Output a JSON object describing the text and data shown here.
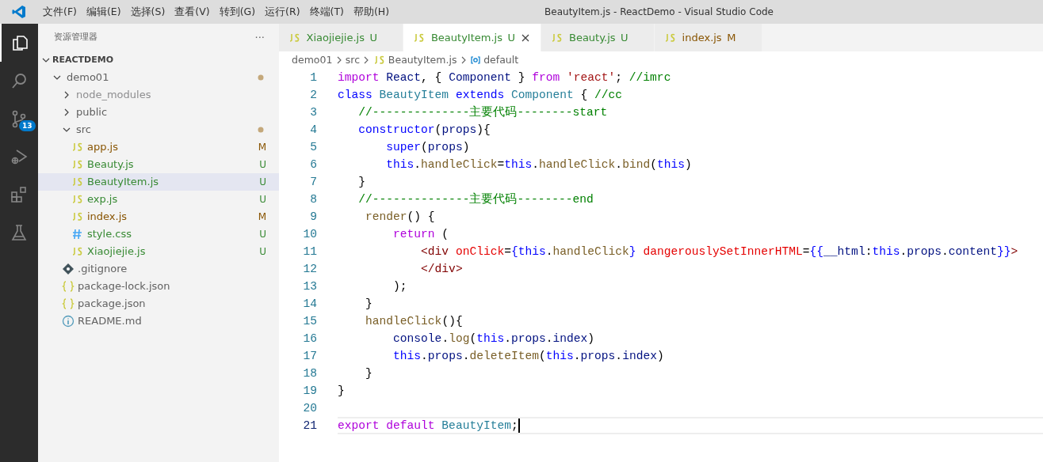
{
  "window": {
    "title": "BeautyItem.js - ReactDemo - Visual Studio Code"
  },
  "menu": [
    "文件(F)",
    "编辑(E)",
    "选择(S)",
    "查看(V)",
    "转到(G)",
    "运行(R)",
    "终端(T)",
    "帮助(H)"
  ],
  "activity_bar": [
    {
      "kind": "explorer",
      "selected": true
    },
    {
      "kind": "search",
      "selected": false
    },
    {
      "kind": "source-control",
      "selected": false,
      "badge": "13"
    },
    {
      "kind": "run-debug",
      "selected": false
    },
    {
      "kind": "extensions",
      "selected": false
    },
    {
      "kind": "testing",
      "selected": false
    }
  ],
  "sidebar": {
    "title": "资源管理器",
    "more": "···",
    "section": {
      "label": "REACTDEMO",
      "expanded": true
    },
    "tree": [
      {
        "label": "demo01",
        "kind": "folder",
        "expanded": true,
        "changes_dot": true,
        "ignored": false,
        "selected": false,
        "children": [
          {
            "label": "node_modules",
            "kind": "folder",
            "expanded": false,
            "changes_dot": false,
            "ignored": true,
            "selected": false
          },
          {
            "label": "public",
            "kind": "folder",
            "expanded": false,
            "changes_dot": false,
            "ignored": false,
            "selected": false
          },
          {
            "label": "src",
            "kind": "folder",
            "expanded": true,
            "changes_dot": true,
            "ignored": false,
            "selected": false,
            "children": [
              {
                "label": "app.js",
                "kind": "js",
                "status": "M",
                "ignored": false,
                "selected": false
              },
              {
                "label": "Beauty.js",
                "kind": "js",
                "status": "U",
                "ignored": false,
                "selected": false
              },
              {
                "label": "BeautyItem.js",
                "kind": "js",
                "status": "U",
                "ignored": false,
                "selected": true
              },
              {
                "label": "exp.js",
                "kind": "js",
                "status": "U",
                "ignored": false,
                "selected": false
              },
              {
                "label": "index.js",
                "kind": "js",
                "status": "M",
                "ignored": false,
                "selected": false
              },
              {
                "label": "style.css",
                "kind": "css",
                "status": "U",
                "ignored": false,
                "selected": false
              },
              {
                "label": "Xiaojiejie.js",
                "kind": "js",
                "status": "U",
                "ignored": false,
                "selected": false
              }
            ]
          },
          {
            "label": ".gitignore",
            "kind": "git",
            "ignored": false,
            "selected": false
          },
          {
            "label": "package-lock.json",
            "kind": "json",
            "ignored": false,
            "selected": false
          },
          {
            "label": "package.json",
            "kind": "json",
            "ignored": false,
            "selected": false
          },
          {
            "label": "README.md",
            "kind": "info",
            "ignored": false,
            "selected": false
          }
        ]
      }
    ]
  },
  "tabs": [
    {
      "label": "Xiaojiejie.js",
      "status": "U",
      "selected": false
    },
    {
      "label": "BeautyItem.js",
      "status": "U",
      "selected": true
    },
    {
      "label": "Beauty.js",
      "status": "U",
      "selected": false
    },
    {
      "label": "index.js",
      "status": "M",
      "selected": false
    }
  ],
  "breadcrumb": [
    {
      "label": "demo01",
      "kind": "folder"
    },
    {
      "label": "src",
      "kind": "folder"
    },
    {
      "label": "BeautyItem.js",
      "kind": "js"
    },
    {
      "label": "default",
      "kind": "symbol"
    }
  ],
  "editor": {
    "lines": [
      {
        "number": "1",
        "current": false,
        "tokens": [
          {
            "text": "import",
            "kind": "kw"
          },
          {
            "text": " React",
            "kind": "va"
          },
          {
            "text": ", { ",
            "kind": "pl"
          },
          {
            "text": "Component",
            "kind": "va"
          },
          {
            "text": " } ",
            "kind": "pl"
          },
          {
            "text": "from",
            "kind": "kw"
          },
          {
            "text": " 'react'",
            "kind": "str"
          },
          {
            "text": "; ",
            "kind": "pl"
          },
          {
            "text": "//imrc",
            "kind": "cm"
          }
        ]
      },
      {
        "number": "2",
        "current": false,
        "tokens": [
          {
            "text": "class",
            "kind": "st"
          },
          {
            "text": " BeautyItem",
            "kind": "ty"
          },
          {
            "text": " extends",
            "kind": "st"
          },
          {
            "text": " Component",
            "kind": "ty"
          },
          {
            "text": " { ",
            "kind": "pl"
          },
          {
            "text": "//cc",
            "kind": "cm"
          }
        ]
      },
      {
        "number": "3",
        "current": false,
        "tokens": [
          {
            "text": "   //--------------主要代码--------start",
            "kind": "cm"
          }
        ]
      },
      {
        "number": "4",
        "current": false,
        "tokens": [
          {
            "text": "   constructor",
            "kind": "st"
          },
          {
            "text": "(",
            "kind": "pl"
          },
          {
            "text": "props",
            "kind": "va"
          },
          {
            "text": "){",
            "kind": "pl"
          }
        ]
      },
      {
        "number": "5",
        "current": false,
        "tokens": [
          {
            "text": "       super",
            "kind": "st"
          },
          {
            "text": "(",
            "kind": "pl"
          },
          {
            "text": "props",
            "kind": "va"
          },
          {
            "text": ")",
            "kind": "pl"
          }
        ]
      },
      {
        "number": "6",
        "current": false,
        "tokens": [
          {
            "text": "       this",
            "kind": "st"
          },
          {
            "text": ".",
            "kind": "pl"
          },
          {
            "text": "handleClick",
            "kind": "fn"
          },
          {
            "text": "=",
            "kind": "pl"
          },
          {
            "text": "this",
            "kind": "st"
          },
          {
            "text": ".",
            "kind": "pl"
          },
          {
            "text": "handleClick",
            "kind": "fn"
          },
          {
            "text": ".",
            "kind": "pl"
          },
          {
            "text": "bind",
            "kind": "fn"
          },
          {
            "text": "(",
            "kind": "pl"
          },
          {
            "text": "this",
            "kind": "st"
          },
          {
            "text": ")",
            "kind": "pl"
          }
        ]
      },
      {
        "number": "7",
        "current": false,
        "tokens": [
          {
            "text": "   }",
            "kind": "pl"
          }
        ]
      },
      {
        "number": "8",
        "current": false,
        "tokens": [
          {
            "text": "   //--------------主要代码--------end",
            "kind": "cm"
          }
        ]
      },
      {
        "number": "9",
        "current": false,
        "tokens": [
          {
            "text": "    render",
            "kind": "fn"
          },
          {
            "text": "() {",
            "kind": "pl"
          }
        ]
      },
      {
        "number": "10",
        "current": false,
        "tokens": [
          {
            "text": "        return",
            "kind": "kw"
          },
          {
            "text": " (",
            "kind": "pl"
          }
        ]
      },
      {
        "number": "11",
        "current": false,
        "tokens": [
          {
            "text": "            <div",
            "kind": "tg"
          },
          {
            "text": " onClick",
            "kind": "at"
          },
          {
            "text": "=",
            "kind": "pl"
          },
          {
            "text": "{this",
            "kind": "st"
          },
          {
            "text": ".",
            "kind": "pl"
          },
          {
            "text": "handleClick",
            "kind": "fn"
          },
          {
            "text": "}",
            "kind": "st"
          },
          {
            "text": " dangerouslySetInnerHTML",
            "kind": "at"
          },
          {
            "text": "=",
            "kind": "pl"
          },
          {
            "text": "{{",
            "kind": "st"
          },
          {
            "text": "__html",
            "kind": "va"
          },
          {
            "text": ":",
            "kind": "pl"
          },
          {
            "text": "this",
            "kind": "st"
          },
          {
            "text": ".",
            "kind": "pl"
          },
          {
            "text": "props",
            "kind": "va"
          },
          {
            "text": ".",
            "kind": "pl"
          },
          {
            "text": "content",
            "kind": "va"
          },
          {
            "text": "}}",
            "kind": "st"
          },
          {
            "text": ">",
            "kind": "tg"
          }
        ]
      },
      {
        "number": "12",
        "current": false,
        "tokens": [
          {
            "text": "            </div>",
            "kind": "tg"
          }
        ]
      },
      {
        "number": "13",
        "current": false,
        "tokens": [
          {
            "text": "        );",
            "kind": "pl"
          }
        ]
      },
      {
        "number": "14",
        "current": false,
        "tokens": [
          {
            "text": "    }",
            "kind": "pl"
          }
        ]
      },
      {
        "number": "15",
        "current": false,
        "tokens": [
          {
            "text": "    handleClick",
            "kind": "fn"
          },
          {
            "text": "(){",
            "kind": "pl"
          }
        ]
      },
      {
        "number": "16",
        "current": false,
        "tokens": [
          {
            "text": "        console",
            "kind": "va"
          },
          {
            "text": ".",
            "kind": "pl"
          },
          {
            "text": "log",
            "kind": "fn"
          },
          {
            "text": "(",
            "kind": "pl"
          },
          {
            "text": "this",
            "kind": "st"
          },
          {
            "text": ".",
            "kind": "pl"
          },
          {
            "text": "props",
            "kind": "va"
          },
          {
            "text": ".",
            "kind": "pl"
          },
          {
            "text": "index",
            "kind": "va"
          },
          {
            "text": ")",
            "kind": "pl"
          }
        ]
      },
      {
        "number": "17",
        "current": false,
        "tokens": [
          {
            "text": "        this",
            "kind": "st"
          },
          {
            "text": ".",
            "kind": "pl"
          },
          {
            "text": "props",
            "kind": "va"
          },
          {
            "text": ".",
            "kind": "pl"
          },
          {
            "text": "deleteItem",
            "kind": "fn"
          },
          {
            "text": "(",
            "kind": "pl"
          },
          {
            "text": "this",
            "kind": "st"
          },
          {
            "text": ".",
            "kind": "pl"
          },
          {
            "text": "props",
            "kind": "va"
          },
          {
            "text": ".",
            "kind": "pl"
          },
          {
            "text": "index",
            "kind": "va"
          },
          {
            "text": ")",
            "kind": "pl"
          }
        ]
      },
      {
        "number": "18",
        "current": false,
        "tokens": [
          {
            "text": "    }",
            "kind": "pl"
          }
        ]
      },
      {
        "number": "19",
        "current": false,
        "tokens": [
          {
            "text": "}",
            "kind": "pl"
          }
        ]
      },
      {
        "number": "20",
        "current": false
      },
      {
        "number": "21",
        "current": true,
        "tokens": [
          {
            "text": "export",
            "kind": "kw"
          },
          {
            "text": " default",
            "kind": "kw"
          },
          {
            "text": " BeautyItem",
            "kind": "ty"
          },
          {
            "text": ";",
            "kind": "pl"
          }
        ]
      }
    ]
  }
}
